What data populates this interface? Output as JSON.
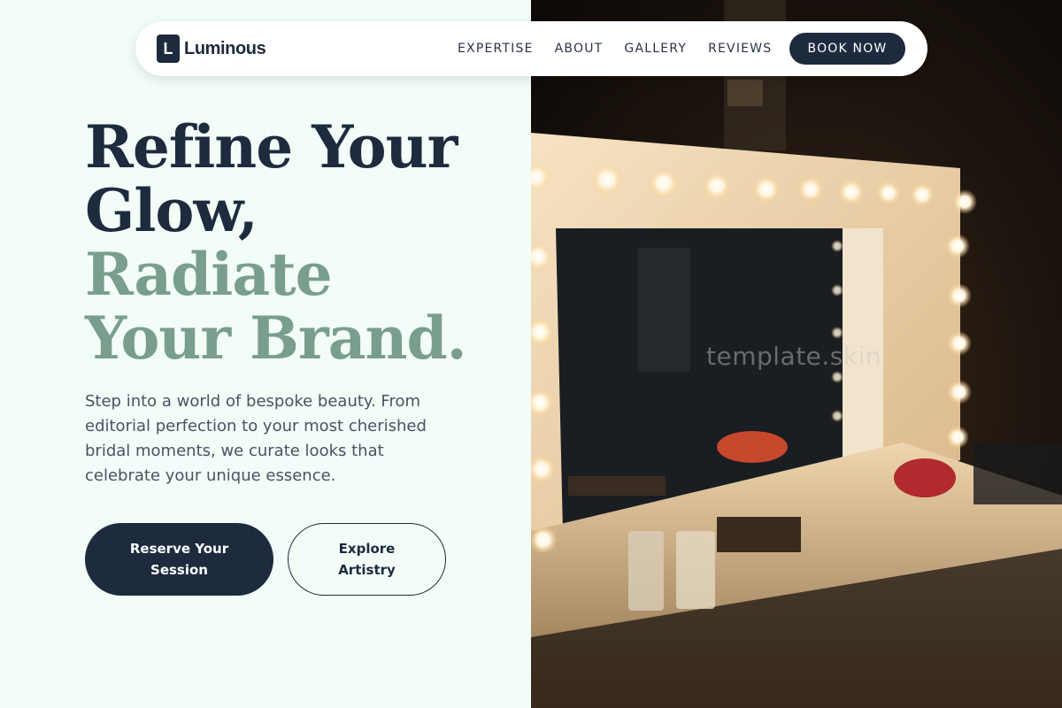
{
  "brand": {
    "logo_letter": "L",
    "name": "Luminous"
  },
  "nav": {
    "links": [
      "EXPERTISE",
      "ABOUT",
      "GALLERY",
      "REVIEWS"
    ],
    "cta": "BOOK NOW"
  },
  "hero": {
    "title_line1": "Refine Your",
    "title_line2": "Glow,",
    "title_line3": "Radiate",
    "title_line4": "Your Brand.",
    "description": "Step into a world of bespoke beauty. From editorial perfection to your most cherished bridal moments, we curate looks that celebrate your unique essence.",
    "primary_button": "Reserve Your Session",
    "secondary_button": "Explore Artistry"
  },
  "watermark": "template.skin",
  "colors": {
    "navy": "#1e2a3e",
    "sage": "#7a9e8c",
    "mint_bg": "#f2fdf8"
  }
}
